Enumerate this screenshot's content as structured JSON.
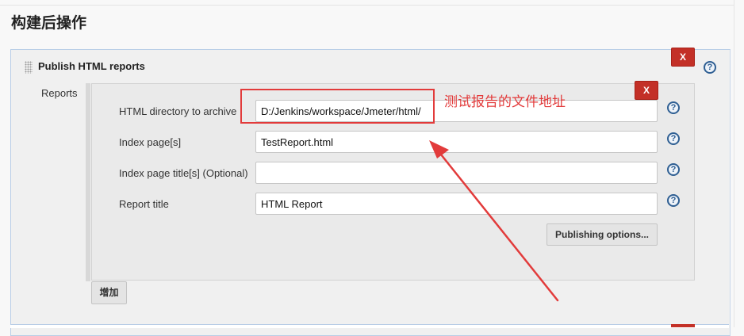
{
  "section_title": "构建后操作",
  "publisher": {
    "heading": "Publish HTML reports",
    "delete_label": "X",
    "help_glyph": "?",
    "reports_label": "Reports",
    "report": {
      "delete_label": "X",
      "fields": [
        {
          "label": "HTML directory to archive",
          "value": "D:/Jenkins/workspace/Jmeter/html/"
        },
        {
          "label": "Index page[s]",
          "value": "TestReport.html"
        },
        {
          "label": "Index page title[s] (Optional)",
          "value": ""
        },
        {
          "label": "Report title",
          "value": "HTML Report"
        }
      ],
      "publishing_options_label": "Publishing options..."
    },
    "add_label": "增加"
  },
  "annotation": {
    "text": "测试报告的文件地址",
    "color": "#e23b3b"
  },
  "colors": {
    "delete_button": "#c33027",
    "help_icon": "#2f5f93",
    "panel_border": "#b8cde6"
  }
}
